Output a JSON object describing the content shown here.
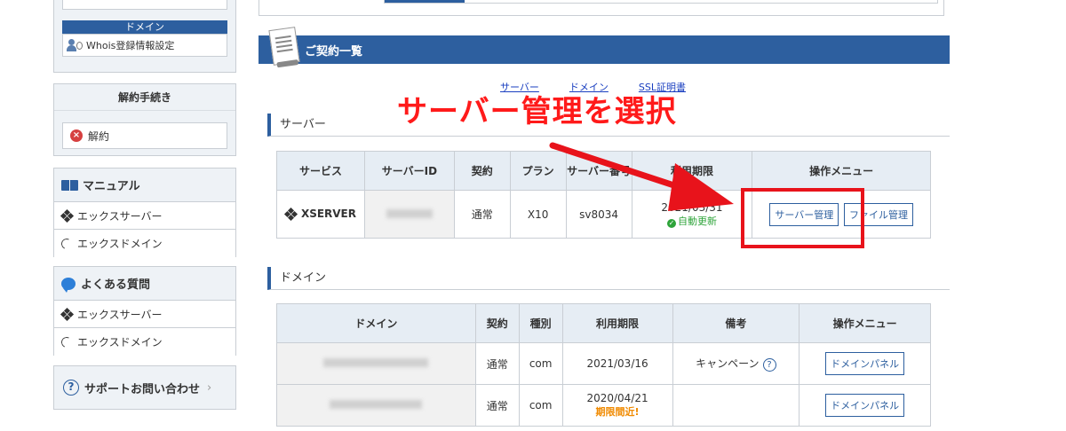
{
  "sidebar": {
    "domain_band": "ドメイン",
    "whois": "Whois登録情報設定",
    "cancel": {
      "head": "解約手続き",
      "item": "解約"
    },
    "manual": {
      "head": "マニュアル",
      "items": [
        "エックスサーバー",
        "エックスドメイン"
      ]
    },
    "faq": {
      "head": "よくある質問",
      "items": [
        "エックスサーバー",
        "エックスドメイン"
      ]
    },
    "support": "サポートお問い合わせ"
  },
  "main": {
    "title": "ご契約一覧",
    "anchors": [
      "サーバー",
      "ドメイン",
      "SSL証明書"
    ],
    "server_section": "サーバー",
    "domain_section": "ドメイン"
  },
  "server_table": {
    "headers": [
      "サービス",
      "サーバーID",
      "契約",
      "プラン",
      "サーバー番号",
      "利用期限",
      "操作メニュー"
    ],
    "row": {
      "service": "XSERVER",
      "contract": "通常",
      "plan": "X10",
      "server_no": "sv8034",
      "expiry": "2021/03/31",
      "auto": "自動更新",
      "btn_server": "サーバー管理",
      "btn_file": "ファイル管理"
    }
  },
  "domain_table": {
    "headers": [
      "ドメイン",
      "契約",
      "種別",
      "利用期限",
      "備考",
      "操作メニュー"
    ],
    "rows": [
      {
        "contract": "通常",
        "type": "com",
        "expiry": "2021/03/16",
        "note": "キャンペーン",
        "btn": "ドメインパネル"
      },
      {
        "contract": "通常",
        "type": "com",
        "expiry": "2020/04/21",
        "warn": "期限間近!",
        "btn": "ドメインパネル"
      }
    ]
  },
  "annotation": {
    "text": "サーバー管理を選択",
    "color": "#ff1a1a"
  },
  "colors": {
    "brand": "#2d5f9f",
    "header_bg": "#e6edf4",
    "ok": "#2ea43a",
    "warn": "#f08a00"
  }
}
